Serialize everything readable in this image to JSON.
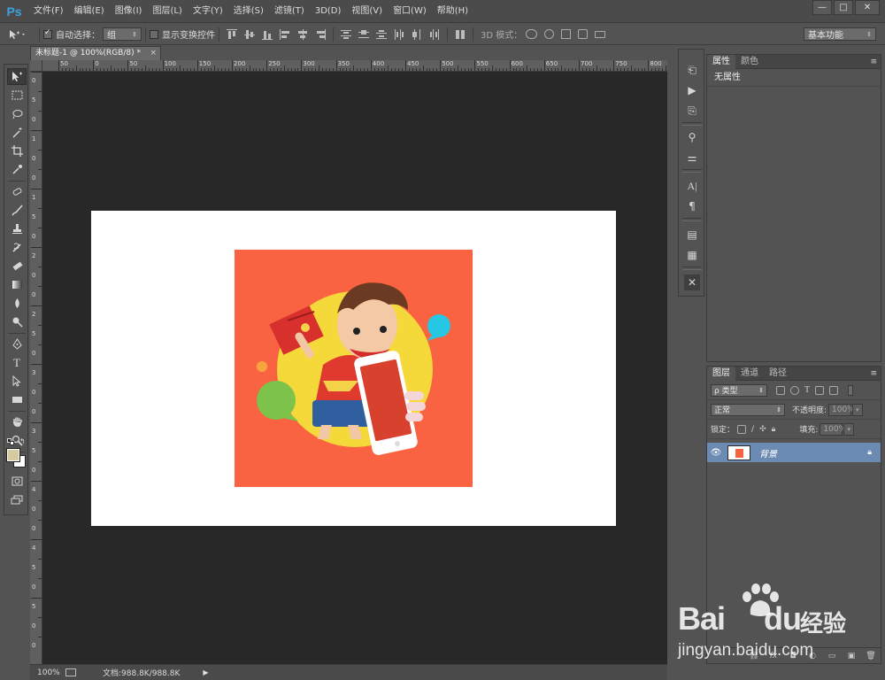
{
  "app": {
    "logo": "Ps"
  },
  "menu": [
    "文件(F)",
    "编辑(E)",
    "图像(I)",
    "图层(L)",
    "文字(Y)",
    "选择(S)",
    "滤镜(T)",
    "3D(D)",
    "视图(V)",
    "窗口(W)",
    "帮助(H)"
  ],
  "window_controls": {
    "minimize": "—",
    "maximize": "□",
    "close": "✕"
  },
  "options": {
    "auto_select_label": "自动选择：",
    "auto_select_checked": true,
    "auto_select_value": "组",
    "show_transform_label": "显示变换控件",
    "show_transform_checked": false,
    "mode_3d_label": "3D 模式：",
    "workspace_value": "基本功能"
  },
  "document": {
    "tab_title": "未标题-1 @ 100%(RGB/8) *",
    "tab_close": "×",
    "ruler_h_labels": [
      "50",
      "0",
      "50",
      "100",
      "150",
      "200",
      "250",
      "300",
      "350",
      "400",
      "450",
      "500",
      "550",
      "600",
      "650",
      "700",
      "750",
      "800"
    ],
    "ruler_v_labels": [
      "0",
      "5",
      "0",
      "1",
      "0",
      "0",
      "1",
      "5",
      "0",
      "2",
      "0",
      "0",
      "2",
      "5",
      "0",
      "3",
      "0",
      "0",
      "3",
      "5",
      "0",
      "4",
      "0",
      "0",
      "4",
      "5",
      "0",
      "5",
      "0",
      "0"
    ]
  },
  "status": {
    "zoom": "100%",
    "doc_info": "文档:988.8K/988.8K"
  },
  "properties_panel": {
    "tabs": [
      "属性",
      "颜色"
    ],
    "content": "无属性",
    "menu": "≡"
  },
  "layers_panel": {
    "tabs": [
      "图层",
      "通道",
      "路径"
    ],
    "menu": "≡",
    "filter_label": "ρ 类型",
    "blend_mode": "正常",
    "opacity_label": "不透明度:",
    "opacity_value": "100%",
    "lock_label": "锁定：",
    "fill_label": "填充:",
    "fill_value": "100%",
    "layer_name": "背景",
    "footer_icons": [
      "link-icon",
      "fx-icon",
      "mask-icon",
      "adjustment-icon",
      "group-icon",
      "new-layer-icon",
      "trash-icon"
    ]
  },
  "watermark": {
    "brand": "Bai",
    "brand_tail": "du",
    "suffix": "经验",
    "url": "jingyan.baidu.com"
  }
}
